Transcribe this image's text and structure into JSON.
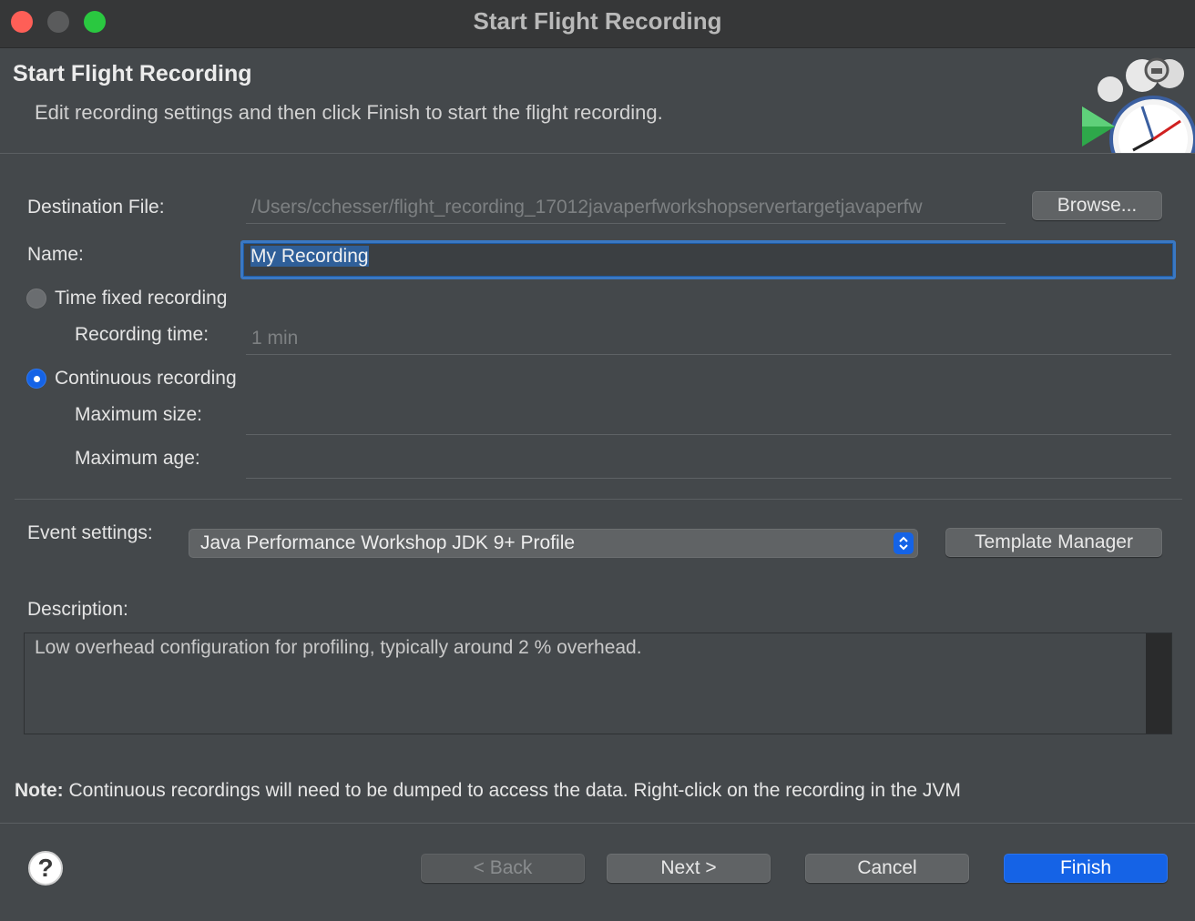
{
  "window": {
    "title": "Start Flight Recording"
  },
  "banner": {
    "title": "Start Flight Recording",
    "description": "Edit recording settings and then click Finish to start the flight recording.",
    "art_icon": "stopwatch-play-icon"
  },
  "form": {
    "destination_label": "Destination File:",
    "destination_value": "/Users/cchesser/flight_recording_17012javaperfworkshopservertargetjavaperfw",
    "browse_label": "Browse...",
    "name_label": "Name:",
    "name_value": "My Recording",
    "time_fixed_label": "Time fixed recording",
    "time_fixed_selected": false,
    "recording_time_label": "Recording time:",
    "recording_time_value": "1 min",
    "continuous_label": "Continuous recording",
    "continuous_selected": true,
    "max_size_label": "Maximum size:",
    "max_size_value": "",
    "max_age_label": "Maximum age:",
    "max_age_value": ""
  },
  "events": {
    "label": "Event settings:",
    "selected": "Java Performance Workshop JDK 9+ Profile",
    "template_manager_label": "Template Manager"
  },
  "description": {
    "label": "Description:",
    "text": "Low overhead configuration for profiling, typically around 2 % overhead."
  },
  "note": {
    "prefix": "Note:",
    "text": " Continuous recordings will need to be dumped to access the data. Right-click on the recording in the JVM"
  },
  "buttons": {
    "back": "< Back",
    "next": "Next >",
    "cancel": "Cancel",
    "finish": "Finish"
  },
  "colors": {
    "accent": "#1563e6",
    "background": "#44484b",
    "titlebar": "#363738"
  }
}
